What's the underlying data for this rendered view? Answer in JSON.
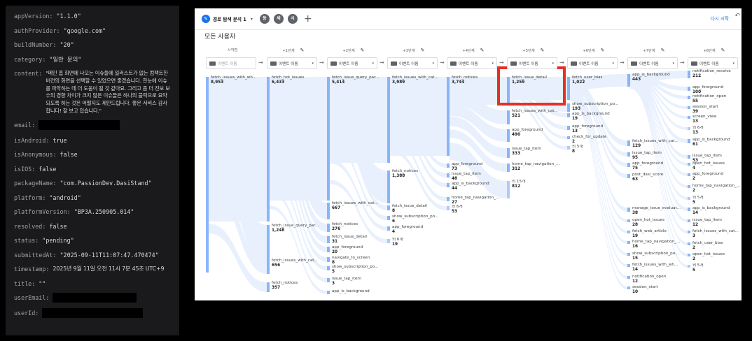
{
  "details": [
    {
      "key": "appVersion:",
      "value": "\"1.1.0\""
    },
    {
      "key": "authProvider:",
      "value": "\"google.com\""
    },
    {
      "key": "buildNumber:",
      "value": "\"20\""
    },
    {
      "key": "category:",
      "value": "\"일반 문의\""
    },
    {
      "key": "content:",
      "value": "\"메인 홈 화면에 나오는 이슈들에 일러스트가 없는 컴팩트한 버전의 화면을 선택할 수 있었으면 좋겠습니다. 한눈에 이슈를 파악하는 데 더 도움이 될 것 같아요. 그리고 좀 더 진보 보수의 경향 차이가 크지 않은 이슈들은 하나의 블럭으로 요약되도록 하는 것은 어떨지도 제안드립니다. 좋은 서비스 감사합니다! 잘 보고 있습니다.\"",
      "multi": true
    },
    {
      "key": "email:",
      "value": "",
      "redacted": true,
      "width": 116
    },
    {
      "key": "isAndroid:",
      "value": "true"
    },
    {
      "key": "isAnonymous:",
      "value": "false"
    },
    {
      "key": "isIOS:",
      "value": "false"
    },
    {
      "key": "packageName:",
      "value": "\"com.PassionDev.DasiStand\""
    },
    {
      "key": "platform:",
      "value": "\"android\""
    },
    {
      "key": "platformVersion:",
      "value": "\"BP3A.250905.014\""
    },
    {
      "key": "resolved:",
      "value": "false"
    },
    {
      "key": "status:",
      "value": "\"pending\""
    },
    {
      "key": "submittedAt:",
      "value": "\"2025-09-11T11:07:47.470474\""
    },
    {
      "key": "timestamp:",
      "value": "2025년 9월 11일 오전 11시 7분 45초 UTC+9",
      "multi": true
    },
    {
      "key": "title:",
      "value": "\"\""
    },
    {
      "key": "userEmail:",
      "value": "",
      "redacted": true,
      "width": 120
    },
    {
      "key": "userId:",
      "value": "",
      "redacted": true,
      "width": 144
    }
  ],
  "explorer": {
    "tab_icon": "✎",
    "tab_title": "경로 탐색 분석 1",
    "round_buttons": [
      "동",
      "세",
      "시"
    ],
    "add_label": "+",
    "restart_label": "다시 시작",
    "undo_icon": "↶",
    "segment": "모든 사용자",
    "step_headers": [
      "시작점",
      "+1단계",
      "+2단계",
      "+3단계",
      "+4단계",
      "+5단계",
      "+6단계",
      "+7단계",
      "+8단계"
    ],
    "dropdowns": [
      "이벤트 이름",
      "이벤트 이름",
      "이벤트 이름",
      "이벤트 이름",
      "이벤트 이름",
      "이벤트 이름",
      "이벤트 이름",
      "이벤트 이름",
      "이벤트 이름"
    ],
    "edit_icon": "✎",
    "arrow_glyph": "→",
    "caret_glyph": "▾",
    "columns": [
      [
        {
          "label": "fetch_issues_with_wh...",
          "value": "8,953"
        }
      ],
      [
        {
          "label": "fetch_hot_issues",
          "value": "6,433"
        },
        {
          "label": "fetch_issue_query_par...",
          "value": "1,248"
        },
        {
          "label": "fetch_issues_with_cat...",
          "value": "656"
        },
        {
          "label": "fetch_notices",
          "value": "357"
        }
      ],
      [
        {
          "label": "fetch_issue_query_par...",
          "value": "5,414"
        },
        {
          "label": "fetch_issues_with_cat...",
          "value": "667"
        },
        {
          "label": "fetch_notices",
          "value": "276"
        },
        {
          "label": "fetch_issue_detail",
          "value": "31"
        },
        {
          "label": "app_foreground",
          "value": "20"
        },
        {
          "label": "navigate_to_screen",
          "value": "8"
        },
        {
          "label": "show_subscription_po...",
          "value": "5"
        },
        {
          "label": "issue_tap_item",
          "value": "3"
        },
        {
          "label": "app_is_background",
          "value": ""
        }
      ],
      [
        {
          "label": "fetch_issues_with_cat...",
          "value": "3,989"
        },
        {
          "label": "fetch_notices",
          "value": "1,388"
        },
        {
          "label": "fetch_issue_detail",
          "value": "8"
        },
        {
          "label": "show_subscription_po...",
          "value": "6"
        },
        {
          "label": "app_foreground",
          "value": "4"
        },
        {
          "label": "외 6개",
          "value": "19"
        }
      ],
      [
        {
          "label": "fetch_notices",
          "value": "3,744"
        },
        {
          "label": "app_foreground",
          "value": "73"
        },
        {
          "label": "issue_tap_item",
          "value": "48"
        },
        {
          "label": "app_is_background",
          "value": "44"
        },
        {
          "label": "home_tap_navigation_...",
          "value": "27"
        },
        {
          "label": "외 6개",
          "value": "53"
        }
      ],
      [
        {
          "label": "fetch_issue_detail",
          "value": "1,259"
        },
        {
          "label": "fetch_issues_with_cat...",
          "value": "521"
        },
        {
          "label": "app_foreground",
          "value": "490"
        },
        {
          "label": "issue_tap_item",
          "value": "333"
        },
        {
          "label": "home_tap_navigation_...",
          "value": "312"
        },
        {
          "label": "외 15개",
          "value": "812"
        }
      ],
      [
        {
          "label": "fetch_user_bias",
          "value": "1,022"
        },
        {
          "label": "show_subscription_po...",
          "value": "193"
        },
        {
          "label": "app_is_background",
          "value": "19"
        },
        {
          "label": "app_foreground",
          "value": "13"
        },
        {
          "label": "check_for_update",
          "value": "2"
        },
        {
          "label": "외 5개",
          "value": "8"
        }
      ],
      [
        {
          "label": "app_is_background",
          "value": "443"
        },
        {
          "label": "fetch_issues_with_cat...",
          "value": "129"
        },
        {
          "label": "issue_tap_item",
          "value": "95"
        },
        {
          "label": "app_foreground",
          "value": "75"
        },
        {
          "label": "post_dasi_score",
          "value": "63"
        },
        {
          "label": "manage_issue_evaluat...",
          "value": "38"
        },
        {
          "label": "open_hot_issues",
          "value": "28"
        },
        {
          "label": "fetch_web_article",
          "value": "19"
        },
        {
          "label": "home_tap_navigation_...",
          "value": "16"
        },
        {
          "label": "show_subscription_po...",
          "value": "15"
        },
        {
          "label": "fetch_issues_with_wh...",
          "value": "14"
        },
        {
          "label": "notification_open",
          "value": "12"
        },
        {
          "label": "session_start",
          "value": "10"
        }
      ],
      [
        {
          "label": "notification_receive",
          "value": "212"
        },
        {
          "label": "app_foreground",
          "value": "100"
        },
        {
          "label": "notification_open",
          "value": "55"
        },
        {
          "label": "session_start",
          "value": "39"
        },
        {
          "label": "screen_view",
          "value": "13"
        },
        {
          "label": "외 6개",
          "value": "13"
        },
        {
          "label": "app_is_background",
          "value": "61"
        },
        {
          "label": "issue_tap_item",
          "value": "53"
        },
        {
          "label": "open_hot_issues",
          "value": "4"
        },
        {
          "label": "app_foreground",
          "value": "2"
        },
        {
          "label": "home_tap_navigation_...",
          "value": "2"
        },
        {
          "label": "외 5개",
          "value": "5"
        },
        {
          "label": "app_is_background",
          "value": "14"
        },
        {
          "label": "issue_tap_item",
          "value": "12"
        },
        {
          "label": "fetch_issues_with_cat...",
          "value": "3"
        },
        {
          "label": "fetch_user_bias",
          "value": "2"
        },
        {
          "label": "open_hot_issues",
          "value": "2"
        },
        {
          "label": "외 5개",
          "value": "5"
        }
      ]
    ],
    "colors": {
      "bar": "#8ab4f8",
      "bar_other": "#aecbfa",
      "link": "#e8f0fe",
      "highlight": "#e53026"
    }
  }
}
